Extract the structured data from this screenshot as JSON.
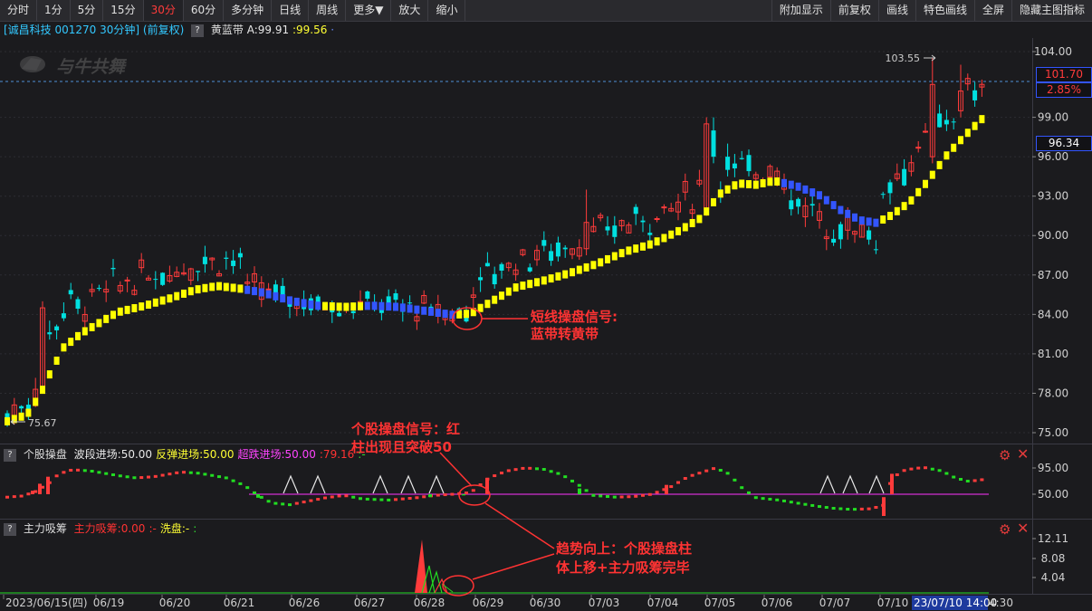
{
  "toolbar": {
    "left": [
      "分时",
      "1分",
      "5分",
      "15分",
      "30分",
      "60分",
      "多分钟",
      "日线",
      "周线",
      "更多▼",
      "放大",
      "缩小"
    ],
    "active_index": 4,
    "right": [
      "附加显示",
      "前复权",
      "画线",
      "特色画线",
      "全屏",
      "隐藏主图指标"
    ]
  },
  "info": {
    "stock": "[诚昌科技 001270 30分钟] (前复权)",
    "indicator_name": "黄蓝带",
    "a_value": "A:99.91",
    "b_value": ":99.56",
    "dot": "·"
  },
  "watermark": "与牛共舞",
  "main_chart": {
    "y_ticks": [
      "104.00",
      "99.00",
      "96.00",
      "93.00",
      "90.00",
      "87.00",
      "84.00",
      "81.00",
      "78.00",
      "75.00"
    ],
    "high_label": "103.55",
    "low_label": "75.67",
    "current_price": "101.70",
    "current_pct": "2.85%",
    "ribbon_price": "96.34"
  },
  "panel1": {
    "title": "个股操盘",
    "items": [
      {
        "label": "波段进场:50.00",
        "color": "#e8e8e8"
      },
      {
        "label": "反弹进场:50.00",
        "color": "#ffff33"
      },
      {
        "label": "超跌进场:50.00",
        "color": "#ff44ff"
      },
      {
        "label": ":79.16",
        "color": "#ff3333"
      },
      {
        "label": ":-",
        "color": "#33dd33"
      }
    ],
    "y_ticks": [
      "95.00",
      "50.00"
    ]
  },
  "panel2": {
    "title": "主力吸筹",
    "items": [
      {
        "label": "主力吸筹:0.00",
        "color": "#ff3333"
      },
      {
        "label": ":-",
        "color": "#ff3333"
      },
      {
        "label": "洗盘:-",
        "color": "#ffff33"
      },
      {
        "label": ":",
        "color": "#33dd33"
      }
    ],
    "y_ticks": [
      "12.11",
      "8.08",
      "4.04"
    ]
  },
  "x_axis": {
    "labels": [
      "2023/06/15(四)",
      "06/19",
      "06/20",
      "06/21",
      "06/26",
      "06/27",
      "06/28",
      "06/29",
      "06/30",
      "07/03",
      "07/04",
      "07/05",
      "07/06",
      "07/07",
      "07/10"
    ],
    "highlight": "23/07/10 14:00",
    "highlight_tail": "4:30"
  },
  "annotations": [
    {
      "lines": [
        "短线操盘信号:",
        "蓝带转黄带"
      ]
    },
    {
      "lines": [
        "个股操盘信号：红",
        "柱出现且突破50"
      ]
    },
    {
      "lines": [
        "趋势向上：个股操盘柱",
        "体上移+主力吸筹完毕"
      ]
    }
  ],
  "colors": {
    "up": "#ff3b3b",
    "down": "#00e0e0",
    "yellow_band": "#ffff00",
    "blue_band": "#3355ff",
    "annot": "#ff3333",
    "grid": "#2d2d33",
    "axis": "#9a9a9a"
  }
}
